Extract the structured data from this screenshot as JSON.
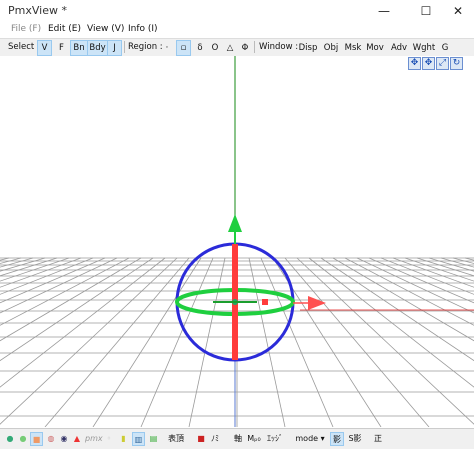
{
  "window": {
    "title": "PmxView *",
    "minimize_glyph": "—",
    "maximize_glyph": "☐",
    "close_glyph": "✕"
  },
  "menu": [
    "File (F)",
    "Edit (E)",
    "View (V)",
    "Info (I)"
  ],
  "toolbar": {
    "select_label": "Select :",
    "select_buttons": [
      "V",
      "F",
      "Bn",
      "Bdy",
      "J"
    ],
    "region_label": "Region :",
    "region_buttons": [
      "·",
      "▫",
      "δ",
      "O",
      "△",
      "Φ"
    ],
    "window_label": "Window :",
    "window_buttons": [
      "Disp",
      "Obj",
      "Msk",
      "Mov",
      "Adv",
      "Wght",
      "G"
    ]
  },
  "view_tools": [
    "✥",
    "✥",
    "⤢",
    "↻"
  ],
  "status": {
    "pmx_text": "pmx",
    "face_label": "表頂",
    "nomi_label": "ﾉﾐ",
    "axis_label": "軸",
    "mpos_label": "Mₚ₀",
    "edge_label": "ｴｯｼﾞ",
    "mode_label": "mode ▾",
    "shadow_label": "影",
    "sshadow_label": "S影",
    "sei_label": "正"
  },
  "colors": {
    "accent": "#0078d7",
    "gizmo_x": "#ff3b3b",
    "gizmo_y": "#1fcf3f",
    "gizmo_ring": "#2b2bd9",
    "axis_red": "#e01a1a",
    "grid": "#9a9a9a"
  }
}
